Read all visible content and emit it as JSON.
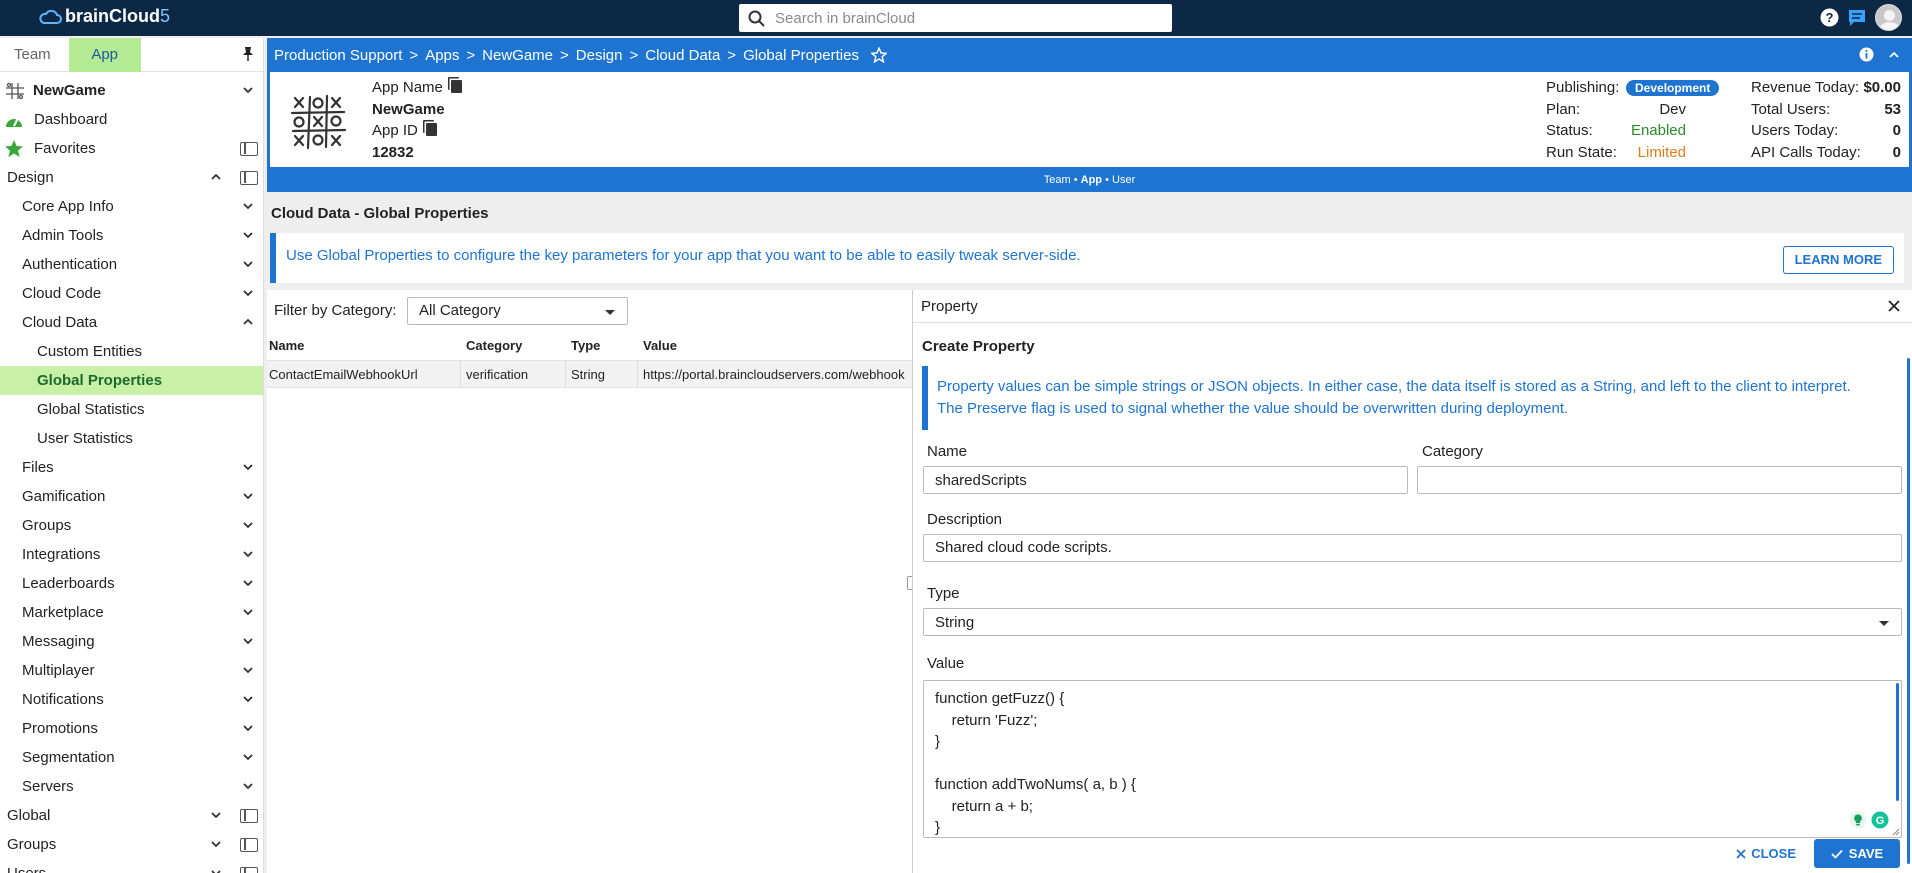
{
  "app": {
    "brand": "brainCloud",
    "version": "5"
  },
  "search": {
    "placeholder": "Search in brainCloud"
  },
  "sidebar": {
    "tabs": [
      "Team",
      "App"
    ],
    "app_name": "NewGame",
    "dashboard": "Dashboard",
    "favorites": "Favorites",
    "design": "Design",
    "design_items": [
      "Core App Info",
      "Admin Tools",
      "Authentication",
      "Cloud Code",
      "Cloud Data"
    ],
    "cloud_data_items": [
      "Custom Entities",
      "Global Properties",
      "Global Statistics",
      "User Statistics"
    ],
    "design_items2": [
      "Files",
      "Gamification",
      "Groups",
      "Integrations",
      "Leaderboards",
      "Marketplace",
      "Messaging",
      "Multiplayer",
      "Notifications",
      "Promotions",
      "Segmentation",
      "Servers"
    ],
    "sections": [
      "Global",
      "Groups",
      "Users"
    ]
  },
  "breadcrumb": [
    "Production Support",
    "Apps",
    "NewGame",
    "Design",
    "Cloud Data",
    "Global Properties"
  ],
  "app_info": {
    "name_label": "App Name",
    "name": "NewGame",
    "id_label": "App ID",
    "id": "12832",
    "publishing_label": "Publishing:",
    "publishing": "Development",
    "plan_label": "Plan:",
    "plan": "Dev",
    "status_label": "Status:",
    "status": "Enabled",
    "run_state_label": "Run State:",
    "run_state": "Limited",
    "revenue_label": "Revenue Today:",
    "revenue": "$0.00",
    "total_users_label": "Total Users:",
    "total_users": "53",
    "users_today_label": "Users Today:",
    "users_today": "0",
    "api_calls_label": "API Calls Today:",
    "api_calls": "0"
  },
  "mode_bar": {
    "team": "Team",
    "app": "App",
    "user": "User"
  },
  "page": {
    "title": "Cloud Data - Global Properties",
    "info": "Use Global Properties to configure the key parameters for your app that you want to be able to easily tweak server-side.",
    "learn_more": "LEARN MORE",
    "filter_label": "Filter by Category:",
    "filter_value": "All Category"
  },
  "table": {
    "columns": [
      "Name",
      "Category",
      "Type",
      "Value"
    ],
    "rows": [
      {
        "name": "ContactEmailWebhookUrl",
        "category": "verification",
        "type": "String",
        "value": "https://portal.braincloudservers.com/webhook"
      }
    ]
  },
  "property_panel": {
    "header": "Property",
    "title": "Create Property",
    "info": "Property values can be simple strings or JSON objects. In either case, the data itself is stored as a String, and left to the client to interpret. The Preserve flag is used to signal whether the value should be overwritten during deployment.",
    "name_label": "Name",
    "name_value": "sharedScripts",
    "category_label": "Category",
    "category_value": "",
    "description_label": "Description",
    "description_value": "Shared cloud code scripts.",
    "type_label": "Type",
    "type_value": "String",
    "value_label": "Value",
    "value_lines": [
      "function getFuzz() {",
      "    return 'Fuzz';",
      "}",
      "",
      "function addTwoNums( a, b ) {",
      "    return a + b;",
      "}"
    ],
    "close": "CLOSE",
    "save": "SAVE"
  },
  "colors": {
    "topbar": "#0d2844",
    "accent": "#1e74d0",
    "active_nav": "#c8f0a6",
    "enabled": "#2b8b2b",
    "limited": "#e27a1b"
  }
}
